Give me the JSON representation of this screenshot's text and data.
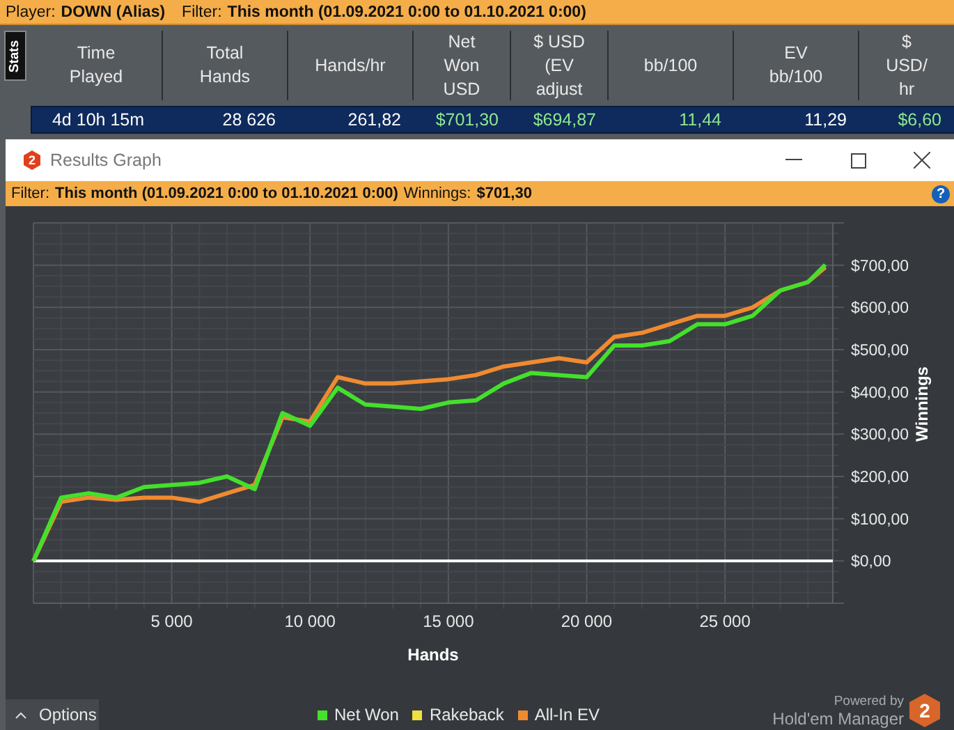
{
  "top_bar": {
    "player_label": "Player:",
    "player": "DOWN (Alias)",
    "filter_label": "Filter:",
    "filter": "This month (01.09.2021 0:00 to 01.10.2021 0:00)"
  },
  "stats": {
    "tab": "Stats",
    "columns": [
      "Time Played",
      "Total Hands",
      "Hands/hr",
      "Net Won USD",
      "$ USD (EV adjust",
      "bb/100",
      "EV bb/100",
      "$ USD/ hr"
    ],
    "rows": [
      {
        "selected": true,
        "cells": [
          {
            "text": "4d 10h 15m",
            "color": "#ffffff"
          },
          {
            "text": "28 626",
            "color": "#ffffff"
          },
          {
            "text": "261,82",
            "color": "#ffffff"
          },
          {
            "text": "$701,30",
            "color": "#8ee88e"
          },
          {
            "text": "$694,87",
            "color": "#8ee88e"
          },
          {
            "text": "11,44",
            "color": "#8ee88e"
          },
          {
            "text": "11,29",
            "color": "#ffffff"
          },
          {
            "text": "$6,60",
            "color": "#8ee88e"
          }
        ]
      }
    ]
  },
  "graph_window": {
    "title": "Results Graph",
    "app_badge": "2",
    "filter_label": "Filter:",
    "filter": "This month (01.09.2021 0:00 to 01.10.2021 0:00)",
    "winnings_label": "Winnings:",
    "winnings": "$701,30",
    "help": "?",
    "chart_data": {
      "type": "line",
      "grid": true,
      "xlabel": "Hands",
      "ylabel": "Winnings",
      "x": [
        0,
        1000,
        2000,
        3000,
        4000,
        5000,
        6000,
        7000,
        8000,
        9000,
        10000,
        11000,
        12000,
        13000,
        14000,
        15000,
        16000,
        17000,
        18000,
        19000,
        20000,
        21000,
        22000,
        23000,
        24000,
        25000,
        26000,
        27000,
        28000,
        28626
      ],
      "series": [
        {
          "name": "Net Won",
          "color": "#44e02c",
          "values": [
            0,
            150,
            160,
            150,
            175,
            180,
            185,
            200,
            170,
            350,
            320,
            410,
            370,
            365,
            360,
            375,
            380,
            420,
            445,
            440,
            435,
            510,
            510,
            520,
            560,
            560,
            580,
            640,
            660,
            701
          ]
        },
        {
          "name": "Rakeback",
          "color": "#f0e040",
          "values": [
            null,
            null,
            null,
            null,
            null,
            null,
            null,
            null,
            null,
            null,
            null,
            null,
            null,
            null,
            null,
            null,
            null,
            null,
            null,
            null,
            null,
            null,
            null,
            null,
            null,
            null,
            null,
            null,
            null,
            null
          ]
        },
        {
          "name": "All-In EV",
          "color": "#f08a30",
          "values": [
            0,
            140,
            150,
            145,
            150,
            150,
            140,
            160,
            180,
            340,
            330,
            435,
            420,
            420,
            425,
            430,
            440,
            460,
            470,
            480,
            470,
            530,
            540,
            560,
            580,
            580,
            600,
            640,
            660,
            695
          ]
        }
      ],
      "xlim": [
        0,
        28900
      ],
      "ylim": [
        -100,
        800
      ],
      "xticks": [
        {
          "value": 5000,
          "label": "5 000"
        },
        {
          "value": 10000,
          "label": "10 000"
        },
        {
          "value": 15000,
          "label": "15 000"
        },
        {
          "value": 20000,
          "label": "20 000"
        },
        {
          "value": 25000,
          "label": "25 000"
        }
      ],
      "yticks": [
        {
          "value": 0,
          "label": "$0,00"
        },
        {
          "value": 100,
          "label": "$100,00"
        },
        {
          "value": 200,
          "label": "$200,00"
        },
        {
          "value": 300,
          "label": "$300,00"
        },
        {
          "value": 400,
          "label": "$400,00"
        },
        {
          "value": 500,
          "label": "$500,00"
        },
        {
          "value": 600,
          "label": "$600,00"
        },
        {
          "value": 700,
          "label": "$700,00"
        }
      ]
    },
    "options_button": "Options",
    "branding": {
      "powered_by": "Powered by",
      "product": "Hold'em Manager",
      "logo": "2"
    }
  }
}
